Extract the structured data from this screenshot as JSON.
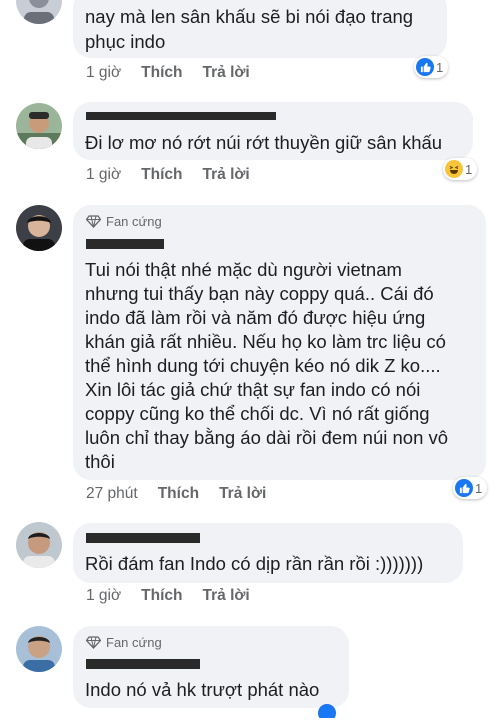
{
  "comments": [
    {
      "text_lines": [
        "nay mà len sân khấu sẽ bi nói đạo trang",
        "phục indo"
      ],
      "time": "1 giờ",
      "like": "Thích",
      "reply": "Trả lời",
      "reaction": {
        "icon": "like-icon",
        "count": "1"
      }
    },
    {
      "text_lines": [
        "Đi lơ mơ nó rớt núi rớt thuyền giữ sân khấu"
      ],
      "time": "1 giờ",
      "like": "Thích",
      "reply": "Trả lời",
      "reaction": {
        "icon": "haha-icon",
        "count": "1"
      }
    },
    {
      "badge": "Fan cứng",
      "text_lines": [
        "Tui nói thật nhé mặc dù người vietnam",
        "nhưng tui thấy bạn này coppy quá.. Cái đó",
        "indo đã làm rồi và năm đó được hiệu ứng",
        "khán giả rất nhiều. Nếu họ ko làm trc liệu có",
        "thể hình dung tới chuyện kéo nó dik Z ko....",
        "Xin lôi tác giả chứ thật sự fan indo có nói",
        "coppy cũng ko thể chối dc. Vì nó rất giống",
        "luôn chỉ thay bằng áo dài rồi đem núi non vô",
        "thôi"
      ],
      "time": "27 phút",
      "like": "Thích",
      "reply": "Trả lời",
      "reaction": {
        "icon": "like-icon",
        "count": "1"
      }
    },
    {
      "text_lines": [
        "Rồi đám fan Indo có dịp rần rần rồi :)))))))"
      ],
      "time": "1 giờ",
      "like": "Thích",
      "reply": "Trả lời"
    },
    {
      "badge": "Fan cứng",
      "text_lines": [
        "Indo nó vả hk trượt phát nào"
      ]
    }
  ],
  "colors": {
    "accent": "#1877f2",
    "bubble": "#f0f2f5",
    "meta": "#65676b",
    "haha": "#f7c43c"
  }
}
